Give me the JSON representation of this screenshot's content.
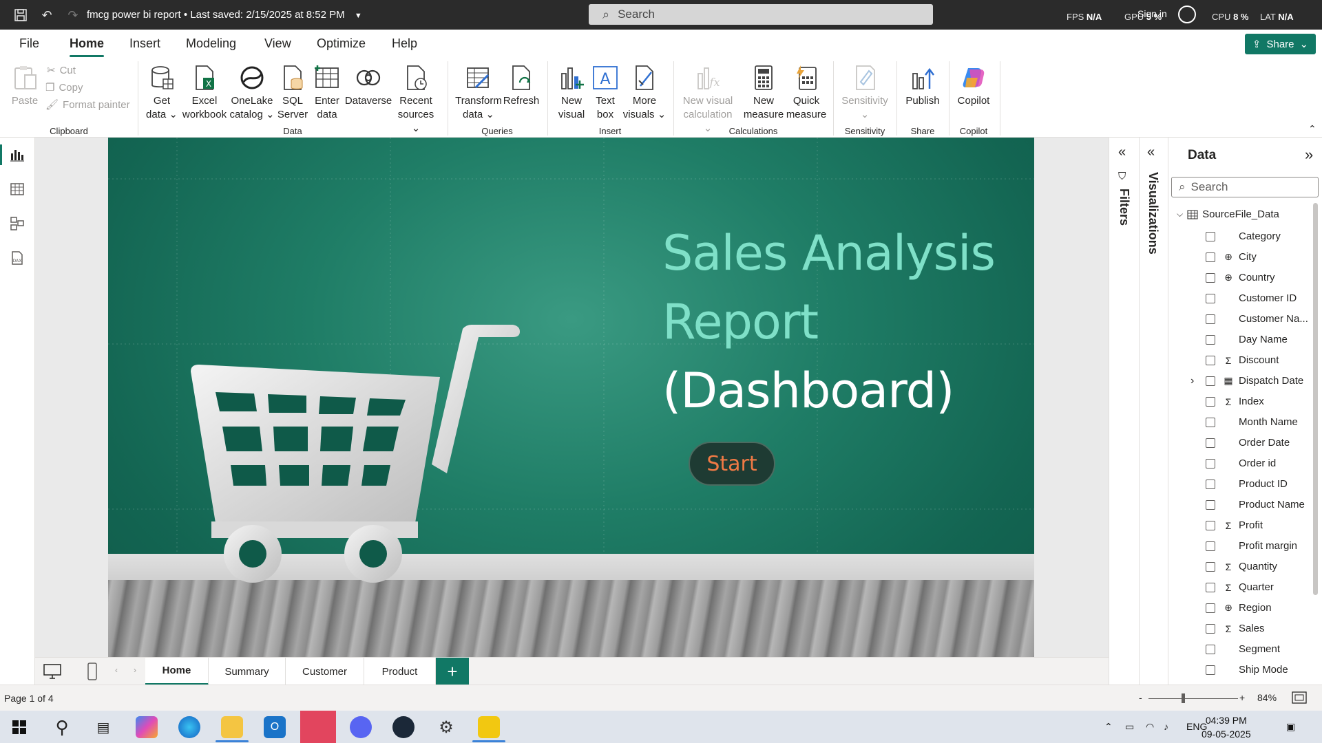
{
  "titlebar": {
    "title": "fmcg power bi report",
    "saved": "Last saved: 2/15/2025 at 8:52 PM",
    "search_placeholder": "Search",
    "fps_label": "FPS",
    "fps_value": "N/A",
    "gpu_label": "GPU",
    "gpu_value": "5 %",
    "cpu_label": "CPU",
    "cpu_value": "8 %",
    "lat_label": "LAT",
    "lat_value": "N/A",
    "signin": "Sign in"
  },
  "tabs": [
    "File",
    "Home",
    "Insert",
    "Modeling",
    "View",
    "Optimize",
    "Help"
  ],
  "share": "Share",
  "ribbon": {
    "paste": "Paste",
    "cut": "Cut",
    "copy": "Copy",
    "format_painter": "Format painter",
    "clipboard": "Clipboard",
    "get_data": [
      "Get",
      "data"
    ],
    "excel": [
      "Excel",
      "workbook"
    ],
    "onelake": [
      "OneLake",
      "catalog"
    ],
    "sql": [
      "SQL",
      "Server"
    ],
    "enter": [
      "Enter",
      "data"
    ],
    "dataverse": "Dataverse",
    "recent": [
      "Recent",
      "sources"
    ],
    "data_group": "Data",
    "transform": [
      "Transform",
      "data"
    ],
    "refresh": "Refresh",
    "queries": "Queries",
    "new_visual": [
      "New",
      "visual"
    ],
    "text_box": [
      "Text",
      "box"
    ],
    "more_visuals": [
      "More",
      "visuals"
    ],
    "insert_group": "Insert",
    "new_visual_calc": [
      "New visual",
      "calculation"
    ],
    "new_measure": [
      "New",
      "measure"
    ],
    "quick_measure": [
      "Quick",
      "measure"
    ],
    "calculations": "Calculations",
    "sensitivity": "Sensitivity",
    "sensitivity_group": "Sensitivity",
    "publish": "Publish",
    "share_group": "Share",
    "copilot": "Copilot",
    "copilot_group": "Copilot"
  },
  "report": {
    "title_line1": "Sales Analysis",
    "title_line2": "Report",
    "title_line3": "(Dashboard)",
    "start": "Start"
  },
  "panes": {
    "filters": "Filters",
    "visualizations": "Visualizations",
    "data": "Data",
    "data_search": "Search",
    "table": "SourceFile_Data",
    "fields": [
      {
        "name": "Category",
        "type": ""
      },
      {
        "name": "City",
        "type": "globe"
      },
      {
        "name": "Country",
        "type": "globe"
      },
      {
        "name": "Customer ID",
        "type": ""
      },
      {
        "name": "Customer Na...",
        "type": ""
      },
      {
        "name": "Day Name",
        "type": ""
      },
      {
        "name": "Discount",
        "type": "sigma"
      },
      {
        "name": "Dispatch Date",
        "type": "calendar"
      },
      {
        "name": "Index",
        "type": "sigma"
      },
      {
        "name": "Month Name",
        "type": ""
      },
      {
        "name": "Order Date",
        "type": ""
      },
      {
        "name": "Order id",
        "type": ""
      },
      {
        "name": "Product ID",
        "type": ""
      },
      {
        "name": "Product Name",
        "type": ""
      },
      {
        "name": "Profit",
        "type": "sigma"
      },
      {
        "name": "Profit margin",
        "type": ""
      },
      {
        "name": "Quantity",
        "type": "sigma"
      },
      {
        "name": "Quarter",
        "type": "sigma"
      },
      {
        "name": "Region",
        "type": "globe"
      },
      {
        "name": "Sales",
        "type": "sigma"
      },
      {
        "name": "Segment",
        "type": ""
      },
      {
        "name": "Ship Mode",
        "type": ""
      }
    ]
  },
  "pages": [
    "Home",
    "Summary",
    "Customer",
    "Product"
  ],
  "status": {
    "page": "Page 1 of 4",
    "zoom": "84%",
    "minus": "-",
    "plus": "+"
  },
  "taskbar": {
    "lang": "ENG",
    "time": "04:39 PM",
    "date": "09-05-2025"
  },
  "colors": {
    "accent": "#117865",
    "title_teal": "#7fe0c8",
    "start_text": "#f07a45"
  }
}
